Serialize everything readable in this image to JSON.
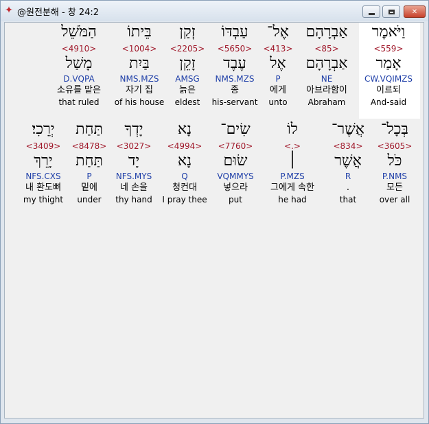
{
  "window": {
    "title": "@원전분해 - 창 24:2",
    "icon": "book-icon",
    "buttons": {
      "minimize": "minimize-icon",
      "maximize": "maximize-icon",
      "close": "close-icon"
    }
  },
  "rows": [
    {
      "words": [
        {
          "heb": "וַיֹּאמֶר",
          "strong": "<559>",
          "lemma": "אָמַר",
          "parse": "CW.VQIMZS",
          "kor": "이르되",
          "eng": "And-said",
          "selected": true
        },
        {
          "heb": "אַבְרָהָם",
          "strong": "<85>",
          "lemma": "אַבְרָהָם",
          "parse": "NE",
          "kor": "아브라함이",
          "eng": "Abraham"
        },
        {
          "heb": "אֶל־",
          "strong": "<413>",
          "lemma": "אֶל",
          "parse": "P",
          "kor": "에게",
          "eng": "unto"
        },
        {
          "heb": "עַבְדּוֹ",
          "strong": "<5650>",
          "lemma": "עֶבֶד",
          "parse": "NMS.MZS",
          "kor": "종",
          "eng": "his-servant"
        },
        {
          "heb": "זְקַן",
          "strong": "<2205>",
          "lemma": "זָקֵן",
          "parse": "AMSG",
          "kor": "늙은",
          "eng": "eldest"
        },
        {
          "heb": "בֵּיתוֹ",
          "strong": "<1004>",
          "lemma": "בַּיִת",
          "parse": "NMS.MZS",
          "kor": "자기 집",
          "eng": "of his house"
        },
        {
          "heb": "הַמֹּשֵׁל",
          "strong": "<4910>",
          "lemma": "מָשַׁל",
          "parse": "D.VQPA",
          "kor": "소유를 맡은",
          "eng": "that ruled"
        }
      ]
    },
    {
      "words": [
        {
          "heb": "בְּכָל־",
          "strong": "<3605>",
          "lemma": "כֹּל",
          "parse": "P.NMS",
          "kor": "모든",
          "eng": "over all"
        },
        {
          "heb": "אֲשֶׁר־",
          "strong": "<834>",
          "lemma": "אֲשֶׁר",
          "parse": "R",
          "kor": ".",
          "eng": "that"
        },
        {
          "heb": "לוֹ",
          "strong": "<.>",
          "lemma": "׀",
          "parse": "P.MZS",
          "kor": "그에게 속한",
          "eng": "he had"
        },
        {
          "heb": "שִׂים־",
          "strong": "<7760>",
          "lemma": "שׂוּם",
          "parse": "VQMMYS",
          "kor": "넣으라",
          "eng": "put"
        },
        {
          "heb": "נָא",
          "strong": "<4994>",
          "lemma": "נָא",
          "parse": "Q",
          "kor": "청컨대",
          "eng": "I pray thee"
        },
        {
          "heb": "יָדְךָ",
          "strong": "<3027>",
          "lemma": "יָד",
          "parse": "NFS.MYS",
          "kor": "네 손을",
          "eng": "thy hand"
        },
        {
          "heb": "תַּחַת",
          "strong": "<8478>",
          "lemma": "תַּחַת",
          "parse": "P",
          "kor": "밑에",
          "eng": "under"
        },
        {
          "heb": "יְרֵכִי׃",
          "strong": "<3409>",
          "lemma": "יָרֵךְ",
          "parse": "NFS.CXS",
          "kor": "내 환도뼈",
          "eng": "my thight"
        }
      ]
    }
  ]
}
